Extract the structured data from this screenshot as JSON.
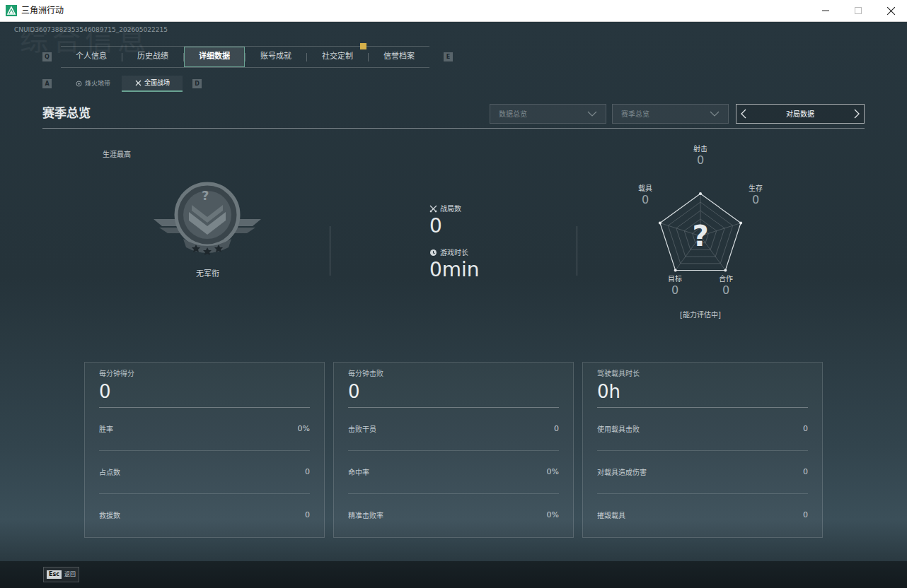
{
  "window": {
    "title": "三角洲行动"
  },
  "uid": "CNUID36073882353546089715_202605022215",
  "watermark": "综合信息",
  "tabs": {
    "prev_key": "Q",
    "next_key": "E",
    "items": [
      {
        "label": "个人信息",
        "selected": false,
        "notice": false
      },
      {
        "label": "历史战绩",
        "selected": false,
        "notice": false
      },
      {
        "label": "详细数据",
        "selected": true,
        "notice": false
      },
      {
        "label": "账号成就",
        "selected": false,
        "notice": false
      },
      {
        "label": "社交定制",
        "selected": false,
        "notice": true
      },
      {
        "label": "信誉档案",
        "selected": false,
        "notice": false
      }
    ]
  },
  "mode_tabs": {
    "prev_key": "A",
    "next_key": "D",
    "items": [
      {
        "label": "烽火地带",
        "selected": false
      },
      {
        "label": "全面战场",
        "selected": true
      }
    ]
  },
  "section": {
    "title": "赛季总览",
    "filters": [
      {
        "label": "数据总览"
      },
      {
        "label": "赛季总览"
      }
    ],
    "switcher": {
      "label": "对局数据"
    }
  },
  "career": {
    "caption": "生涯最高",
    "emblem_mark": "?",
    "rank": "无军衔"
  },
  "summary": [
    {
      "label": "战局数",
      "value": "0",
      "kind": "battles"
    },
    {
      "label": "游戏时长",
      "value": "0min",
      "kind": "time"
    }
  ],
  "radar": {
    "center": "?",
    "note": "[能力评估中]",
    "axes": [
      {
        "label": "射击",
        "value": "0",
        "level": 0
      },
      {
        "label": "生存",
        "value": "0",
        "level": 0
      },
      {
        "label": "合作",
        "value": "0",
        "level": 0
      },
      {
        "label": "目标",
        "value": "0",
        "level": 0
      },
      {
        "label": "载具",
        "value": "0",
        "level": 0
      }
    ]
  },
  "cards": [
    {
      "title": "每分钟得分",
      "value": "0",
      "rows": [
        {
          "label": "胜率",
          "value": "0%"
        },
        {
          "label": "占点数",
          "value": "0"
        },
        {
          "label": "救援数",
          "value": "0"
        }
      ]
    },
    {
      "title": "每分钟击败",
      "value": "0",
      "rows": [
        {
          "label": "击败干员",
          "value": "0"
        },
        {
          "label": "命中率",
          "value": "0%"
        },
        {
          "label": "精准击败率",
          "value": "0%"
        }
      ]
    },
    {
      "title": "驾驶载具时长",
      "value": "0h",
      "rows": [
        {
          "label": "使用载具击败",
          "value": "0"
        },
        {
          "label": "对载具造成伤害",
          "value": "0"
        },
        {
          "label": "摧毁载具",
          "value": "0"
        }
      ]
    }
  ],
  "footer": {
    "key": "Esc",
    "label": "返回"
  }
}
